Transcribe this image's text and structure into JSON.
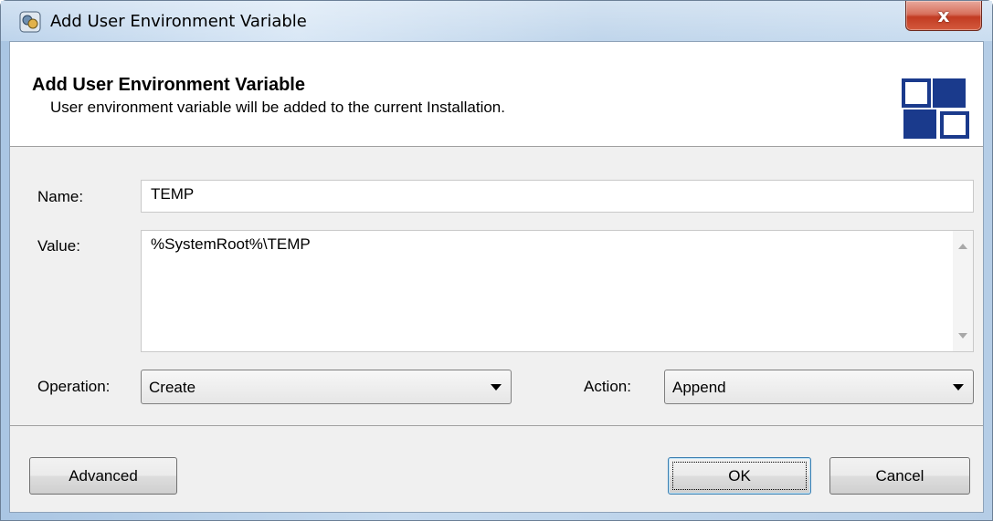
{
  "window": {
    "title": "Add User Environment Variable",
    "close_glyph": "x"
  },
  "header": {
    "title": "Add User Environment Variable",
    "subtitle": "User environment variable will be added to the current Installation."
  },
  "form": {
    "name_label": "Name:",
    "name_value": "TEMP",
    "value_label": "Value:",
    "value_text": "%SystemRoot%\\TEMP",
    "operation_label": "Operation:",
    "operation_selected": "Create",
    "action_label": "Action:",
    "action_selected": "Append"
  },
  "buttons": {
    "advanced": "Advanced",
    "ok": "OK",
    "cancel": "Cancel"
  },
  "colors": {
    "logo_blue": "#1a3a8c",
    "close_red": "#c23b22"
  },
  "icons": {
    "title_icon": "app-icon",
    "header_logo": "blocks-logo-icon"
  }
}
